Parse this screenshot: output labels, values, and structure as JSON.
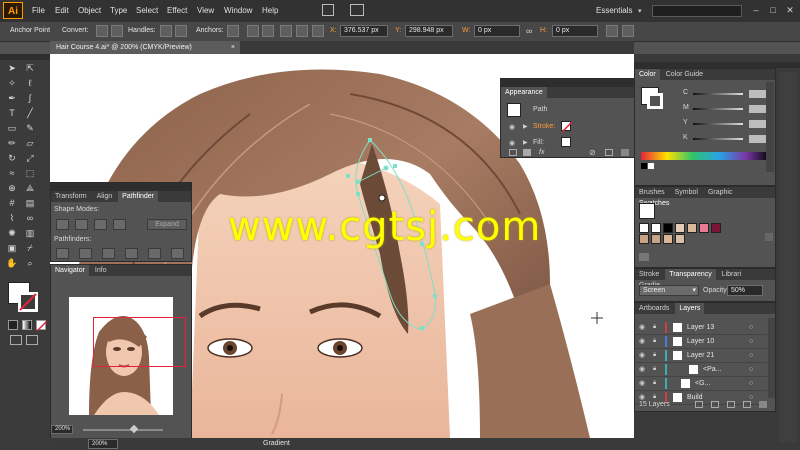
{
  "app": {
    "logo": "Ai",
    "workspace": "Essentials"
  },
  "menu": [
    "File",
    "Edit",
    "Object",
    "Type",
    "Select",
    "Effect",
    "View",
    "Window",
    "Help"
  ],
  "window_buttons": [
    "–",
    "□",
    "✕"
  ],
  "control": {
    "tool_label": "Anchor Point",
    "convert_label": "Convert:",
    "handles_label": "Handles:",
    "anchors_label": "Anchors:",
    "x_label": "X:",
    "x_value": "376.537 px",
    "y_label": "Y:",
    "y_value": "298.948 px",
    "w_label": "W:",
    "w_value": "0 px",
    "h_label": "H:",
    "h_value": "0 px"
  },
  "document": {
    "tab_title": "Hair Course 4.ai* @ 200% (CMYK/Preview)",
    "close": "×"
  },
  "watermark": "www.cgtsj.com",
  "appearance": {
    "tab": "Appearance",
    "path_label": "Path",
    "stroke_label": "Stroke:",
    "fill_label": "Fill:",
    "fx_label": "fx"
  },
  "color_panel": {
    "tabs": [
      "Color",
      "Color Guide"
    ],
    "channels": [
      "C",
      "M",
      "Y",
      "K"
    ],
    "values": [
      0,
      0,
      0,
      0
    ]
  },
  "swatches_panel": {
    "tabs": [
      "Brushes",
      "Symbol",
      "Graphic",
      "Swatches"
    ]
  },
  "transparency_panel": {
    "tabs": [
      "Stroke",
      "Transparency",
      "Librari",
      "Gradie"
    ],
    "mode": "Screen",
    "opacity_label": "Opacity:",
    "opacity_value": "50%"
  },
  "layers_panel": {
    "tabs": [
      "Artboards",
      "Layers"
    ],
    "rows": [
      {
        "name": "Layer 13",
        "color": "#c94040",
        "indent": 0
      },
      {
        "name": "Layer 10",
        "color": "#4a7bd6",
        "indent": 0
      },
      {
        "name": "Layer 21",
        "color": "#38b0b0",
        "indent": 0
      },
      {
        "name": "<Pa...",
        "color": "#38b0b0",
        "indent": 2
      },
      {
        "name": "<G...",
        "color": "#38b0b0",
        "indent": 1
      },
      {
        "name": "Build",
        "color": "#c94040",
        "indent": 0
      }
    ],
    "count": "15 Layers"
  },
  "pathfinder_panel": {
    "tabs": [
      "Transform",
      "Align",
      "Pathfinder"
    ],
    "shape_modes_label": "Shape Modes:",
    "pathfinders_label": "Pathfinders:",
    "expand_label": "Expand"
  },
  "navigator_panel": {
    "tabs": [
      "Navigator",
      "Info"
    ],
    "zoom": "200%"
  },
  "status": {
    "zoom": "200%",
    "tool": "Gradient"
  },
  "colors": {
    "ai_orange": "#ff9a00",
    "path_teal": "#7de0c7",
    "nav_rect": "#e3233c",
    "watermark": "#ffff00"
  },
  "icons": [
    "selection-icon",
    "direct-selection-icon",
    "magic-wand-icon",
    "lasso-icon",
    "pen-icon",
    "type-icon",
    "line-icon",
    "rectangle-icon",
    "paintbrush-icon",
    "pencil-icon",
    "eraser-icon",
    "rotate-icon",
    "scale-icon",
    "warp-icon",
    "free-transform-icon",
    "shape-builder-icon",
    "perspective-icon",
    "mesh-icon",
    "gradient-icon",
    "eyedropper-icon",
    "blend-icon",
    "symbol-sprayer-icon",
    "graph-icon",
    "artboard-icon",
    "slice-icon",
    "hand-icon",
    "zoom-icon"
  ]
}
